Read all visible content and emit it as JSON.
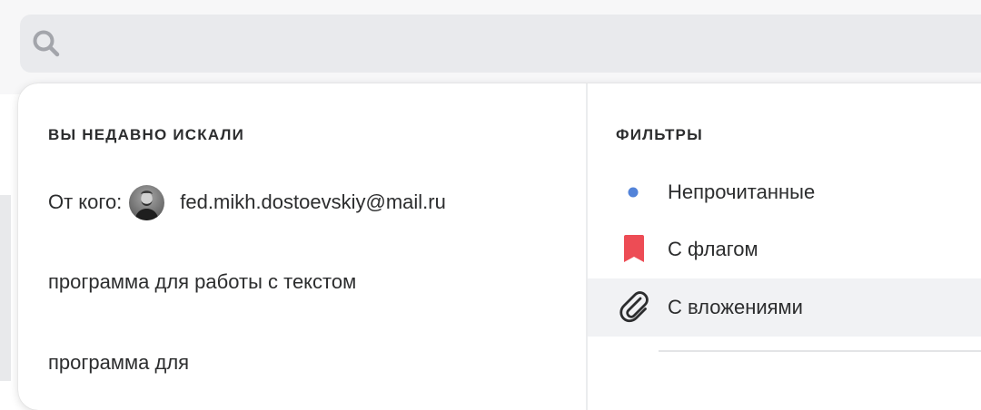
{
  "search": {
    "placeholder": "",
    "value": ""
  },
  "recent": {
    "title": "ВЫ НЕДАВНО ИСКАЛИ",
    "items": [
      {
        "prefix": "От кого:",
        "avatar": "avatar-portrait",
        "label": "fed.mikh.dostoevskiy@mail.ru"
      },
      {
        "label": "программа для работы с текстом"
      },
      {
        "label": "программа для"
      }
    ]
  },
  "filters": {
    "title": "ФИЛЬТРЫ",
    "items": [
      {
        "label": "Непрочитанные",
        "icon": "unread-dot-icon",
        "color": "#5283d9"
      },
      {
        "label": "С флагом",
        "icon": "flag-icon",
        "color": "#ed4c55"
      },
      {
        "label": "С вложениями",
        "icon": "paperclip-icon",
        "color": "#2c2d2e",
        "highlighted": true
      }
    ]
  },
  "colors": {
    "search_bg": "#e9eaed",
    "highlight_bg": "#f1f2f4",
    "text": "#2c2d2e"
  }
}
